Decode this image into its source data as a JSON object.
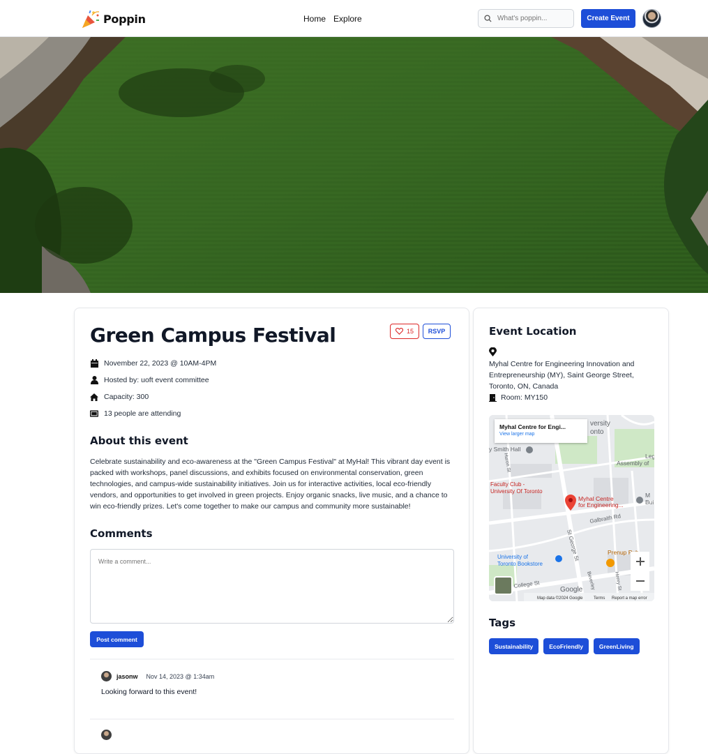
{
  "nav": {
    "brand": "Poppin",
    "links": [
      "Home",
      "Explore"
    ],
    "search_placeholder": "What's poppin...",
    "create_label": "Create Event"
  },
  "event": {
    "title": "Green Campus Festival",
    "likes": "15",
    "rsvp_label": "RSVP",
    "date": "November 22, 2023 @ 10AM-4PM",
    "host": "Hosted by: uoft event committee",
    "capacity": "Capacity: 300",
    "attending": "13 people are attending",
    "about_heading": "About this event",
    "about_text": "Celebrate sustainability and eco-awareness at the \"Green Campus Festival\" at MyHal! This vibrant day event is packed with workshops, panel discussions, and exhibits focused on environmental conservation, green technologies, and campus-wide sustainability initiatives. Join us for interactive activities, local eco-friendly vendors, and opportunities to get involved in green projects. Enjoy organic snacks, live music, and a chance to win eco-friendly prizes. Let's come together to make our campus and community more sustainable!"
  },
  "comments": {
    "heading": "Comments",
    "placeholder": "Write a comment...",
    "post_label": "Post comment",
    "items": [
      {
        "user": "jasonw",
        "time": "Nov 14, 2023 @ 1:34am",
        "text": "Looking forward to this event!"
      }
    ]
  },
  "location": {
    "heading": "Event Location",
    "address": "Myhal Centre for Engineering Innovation and Entrepreneurship (MY), Saint George Street, Toronto, ON, Canada",
    "room": "Room: MY150",
    "map": {
      "popup_title": "Myhal Centre for Engi...",
      "popup_link": "View larger map",
      "labels": {
        "university": "versity",
        "toronto": "onto",
        "smith_hall": "y Smith Hall",
        "assembly": "Assembly of",
        "leg": "Leg",
        "faculty1": "Faculty Club -",
        "faculty2": "University Of Toronto",
        "myhal1": "Myhal Centre",
        "myhal2": "for Engineering...",
        "bui": "Bui",
        "m_label": "M",
        "galbraith": "Galbraith Rd",
        "st_george": "St George St",
        "prenup": "Prenup Pub",
        "bookstore1": "University of",
        "bookstore2": "Toronto Bookstore",
        "huron": "Huron St",
        "beverley": "Beverley",
        "henry": "Henry St",
        "college": "College St",
        "google": "Google",
        "map_data": "Map data ©2024 Google",
        "terms": "Terms",
        "report": "Report a map error"
      }
    }
  },
  "tags": {
    "heading": "Tags",
    "items": [
      "Sustainability",
      "EcoFriendly",
      "GreenLiving"
    ]
  },
  "colors": {
    "primary": "#1d4ed8",
    "like": "#dc2626",
    "grass": "#3a6a22"
  }
}
